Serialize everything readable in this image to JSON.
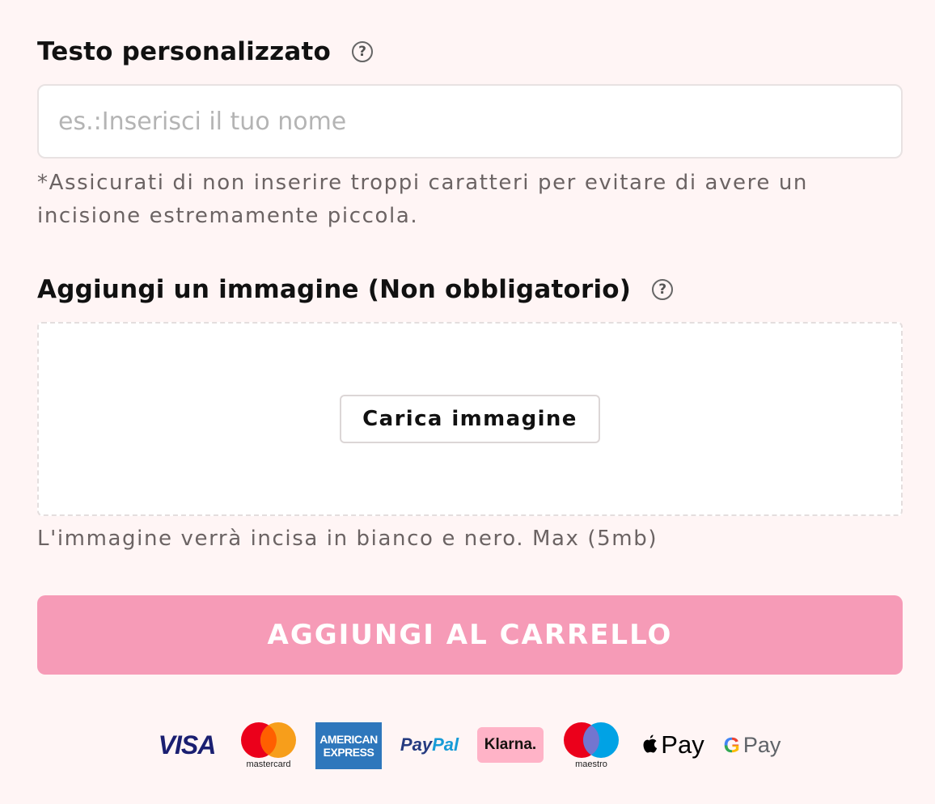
{
  "custom_text": {
    "label": "Testo personalizzato",
    "help_glyph": "?",
    "placeholder": "es.:Inserisci il tuo nome",
    "value": "",
    "note": "*Assicurati di non inserire troppi caratteri per evitare di avere un incisione estremamente piccola."
  },
  "image_upload": {
    "label": "Aggiungi un immagine (Non obbligatorio)",
    "help_glyph": "?",
    "button_label": "Carica immagine",
    "note": "L'immagine verrà incisa in bianco e nero. Max (5mb)"
  },
  "cart": {
    "button_label": "AGGIUNGI AL CARRELLO",
    "color": "#f69bb7"
  },
  "payments": {
    "visa": "VISA",
    "mastercard": "mastercard",
    "amex_line1": "AMERICAN",
    "amex_line2": "EXPRESS",
    "paypal_pay": "Pay",
    "paypal_pal": "Pal",
    "klarna": "Klarna.",
    "maestro": "maestro",
    "applepay": "Pay",
    "gpay_g": "G",
    "gpay": "Pay"
  },
  "colors": {
    "background": "#fff5f5",
    "visa_blue": "#1a1f71",
    "amex_blue": "#2e77bc",
    "paypal_dark": "#253b80",
    "paypal_light": "#179bd7",
    "klarna_pink": "#ffb3c7"
  }
}
